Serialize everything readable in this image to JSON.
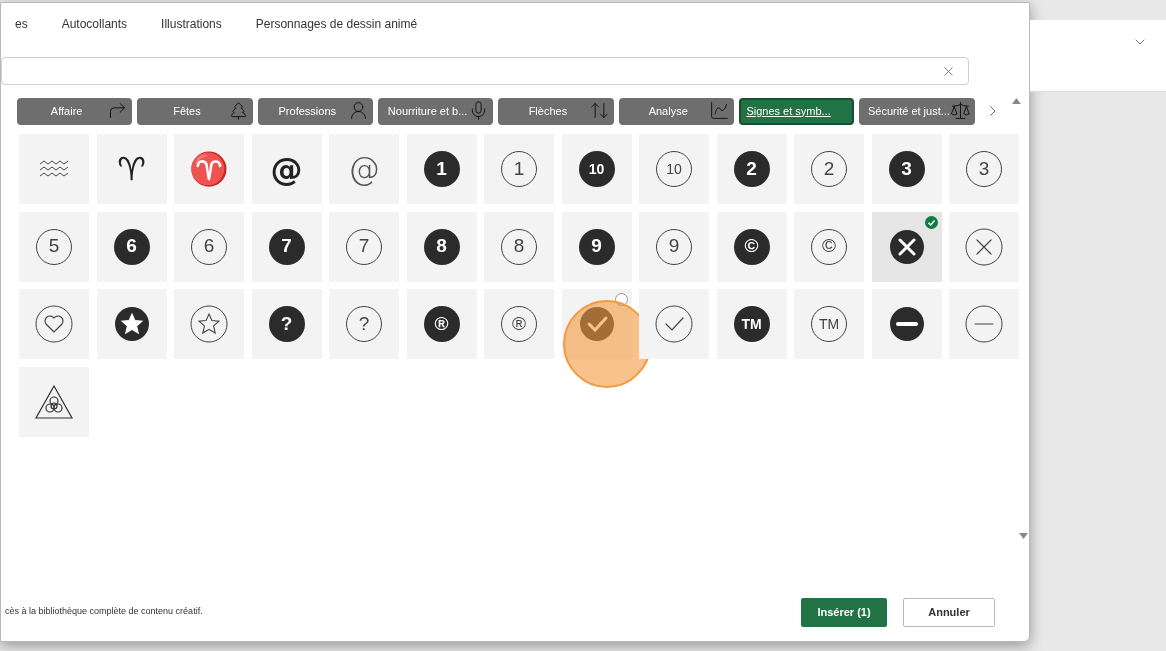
{
  "tabs": [
    {
      "label": "es",
      "selected": false
    },
    {
      "label": "Autocollants",
      "selected": false
    },
    {
      "label": "Illustrations",
      "selected": false
    },
    {
      "label": "Personnages de dessin animé",
      "selected": false
    }
  ],
  "categories": [
    {
      "label": "Affaire",
      "selected": false
    },
    {
      "label": "Fêtes",
      "selected": false
    },
    {
      "label": "Professions",
      "selected": false
    },
    {
      "label": "Nourriture et b...",
      "selected": false
    },
    {
      "label": "Flèches",
      "selected": false
    },
    {
      "label": "Analyse",
      "selected": false
    },
    {
      "label": "Signes et symb...",
      "selected": true
    },
    {
      "label": "Sécurité et just...",
      "selected": false
    }
  ],
  "icons": [
    {
      "kind": "waves",
      "selected": false,
      "hovered": false
    },
    {
      "kind": "glyph-bold",
      "glyph": "♈",
      "selected": false,
      "hovered": false
    },
    {
      "kind": "glyph-light",
      "glyph": "♈",
      "selected": false,
      "hovered": false
    },
    {
      "kind": "glyph-bold",
      "glyph": "@",
      "selected": false,
      "hovered": false
    },
    {
      "kind": "glyph-light",
      "glyph": "@",
      "selected": false,
      "hovered": false
    },
    {
      "kind": "glyph-filled",
      "glyph": "1",
      "selected": false,
      "hovered": false
    },
    {
      "kind": "glyph-outline",
      "glyph": "1",
      "selected": false,
      "hovered": false
    },
    {
      "kind": "glyph-filled",
      "glyph": "10",
      "selected": false,
      "hovered": false
    },
    {
      "kind": "glyph-outline",
      "glyph": "10",
      "selected": false,
      "hovered": false
    },
    {
      "kind": "glyph-filled",
      "glyph": "2",
      "selected": false,
      "hovered": false
    },
    {
      "kind": "glyph-outline",
      "glyph": "2",
      "selected": false,
      "hovered": false
    },
    {
      "kind": "glyph-filled",
      "glyph": "3",
      "selected": false,
      "hovered": false
    },
    {
      "kind": "glyph-outline",
      "glyph": "3",
      "selected": false,
      "hovered": false
    },
    {
      "kind": "glyph-outline",
      "glyph": "5",
      "selected": false,
      "hovered": false
    },
    {
      "kind": "glyph-filled",
      "glyph": "6",
      "selected": false,
      "hovered": false
    },
    {
      "kind": "glyph-outline",
      "glyph": "6",
      "selected": false,
      "hovered": false
    },
    {
      "kind": "glyph-filled",
      "glyph": "7",
      "selected": false,
      "hovered": false
    },
    {
      "kind": "glyph-outline",
      "glyph": "7",
      "selected": false,
      "hovered": false
    },
    {
      "kind": "glyph-filled",
      "glyph": "8",
      "selected": false,
      "hovered": false
    },
    {
      "kind": "glyph-outline",
      "glyph": "8",
      "selected": false,
      "hovered": false
    },
    {
      "kind": "glyph-filled",
      "glyph": "9",
      "selected": false,
      "hovered": false
    },
    {
      "kind": "glyph-outline",
      "glyph": "9",
      "selected": false,
      "hovered": false
    },
    {
      "kind": "glyph-filled",
      "glyph": "©",
      "selected": false,
      "hovered": false
    },
    {
      "kind": "glyph-outline",
      "glyph": "©",
      "selected": false,
      "hovered": false
    },
    {
      "kind": "cross-filled",
      "selected": true,
      "hovered": false
    },
    {
      "kind": "cross-outline",
      "selected": false,
      "hovered": false
    },
    {
      "kind": "heart-outline",
      "selected": false,
      "hovered": false
    },
    {
      "kind": "star-filled",
      "selected": false,
      "hovered": false
    },
    {
      "kind": "star-outline",
      "selected": false,
      "hovered": false
    },
    {
      "kind": "glyph-filled",
      "glyph": "?",
      "selected": false,
      "hovered": false
    },
    {
      "kind": "glyph-outline",
      "glyph": "?",
      "selected": false,
      "hovered": false
    },
    {
      "kind": "glyph-filled",
      "glyph": "®",
      "selected": false,
      "hovered": false
    },
    {
      "kind": "glyph-outline",
      "glyph": "®",
      "selected": false,
      "hovered": false
    },
    {
      "kind": "check-filled",
      "selected": false,
      "hovered": true
    },
    {
      "kind": "check-outline",
      "selected": false,
      "hovered": false
    },
    {
      "kind": "glyph-filled",
      "glyph": "TM",
      "selected": false,
      "hovered": false
    },
    {
      "kind": "glyph-outline",
      "glyph": "TM",
      "selected": false,
      "hovered": false
    },
    {
      "kind": "minus-filled",
      "selected": false,
      "hovered": false
    },
    {
      "kind": "minus-outline",
      "selected": false,
      "hovered": false
    },
    {
      "kind": "biohazard",
      "selected": false,
      "hovered": false
    }
  ],
  "footer": {
    "text": "cès à la bibliothèque complète de contenu créatif.",
    "buttons": [
      {
        "label": "Insérer (1)",
        "kind": "primary"
      },
      {
        "label": "Annuler",
        "kind": "secondary"
      }
    ]
  }
}
